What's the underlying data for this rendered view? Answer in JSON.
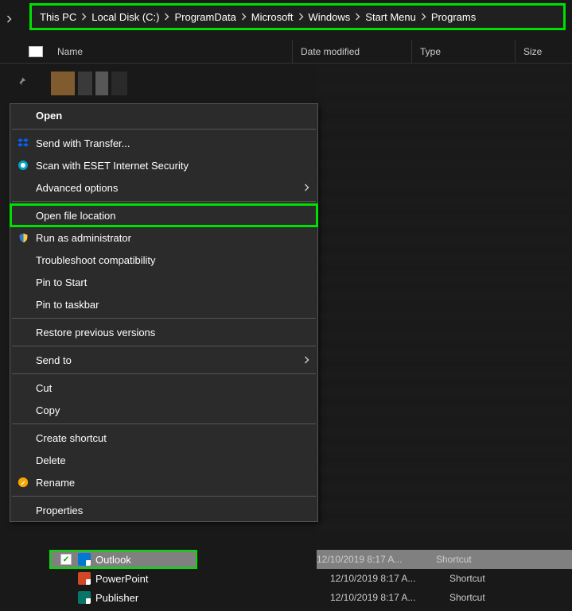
{
  "breadcrumb": [
    "This PC",
    "Local Disk (C:)",
    "ProgramData",
    "Microsoft",
    "Windows",
    "Start Menu",
    "Programs"
  ],
  "columns": {
    "name": "Name",
    "date": "Date modified",
    "type": "Type",
    "size": "Size"
  },
  "context_menu": {
    "open": "Open",
    "send_transfer": "Send with Transfer...",
    "scan_eset": "Scan with ESET Internet Security",
    "advanced": "Advanced options",
    "open_loc": "Open file location",
    "run_admin": "Run as administrator",
    "troubleshoot": "Troubleshoot compatibility",
    "pin_start": "Pin to Start",
    "pin_taskbar": "Pin to taskbar",
    "restore": "Restore previous versions",
    "send_to": "Send to",
    "cut": "Cut",
    "copy": "Copy",
    "create_sc": "Create shortcut",
    "delete": "Delete",
    "rename": "Rename",
    "properties": "Properties"
  },
  "files": [
    {
      "name": "Outlook",
      "date": "12/10/2019 8:17 A...",
      "type": "Shortcut",
      "selected": true,
      "highlighted": true
    },
    {
      "name": "PowerPoint",
      "date": "12/10/2019 8:17 A...",
      "type": "Shortcut",
      "selected": false,
      "highlighted": false
    },
    {
      "name": "Publisher",
      "date": "12/10/2019 8:17 A...",
      "type": "Shortcut",
      "selected": false,
      "highlighted": false
    }
  ],
  "icons": {
    "dropbox": "dropbox-icon",
    "eset": "eset-icon",
    "shield": "shield-icon",
    "pencil": "pencil-icon"
  }
}
